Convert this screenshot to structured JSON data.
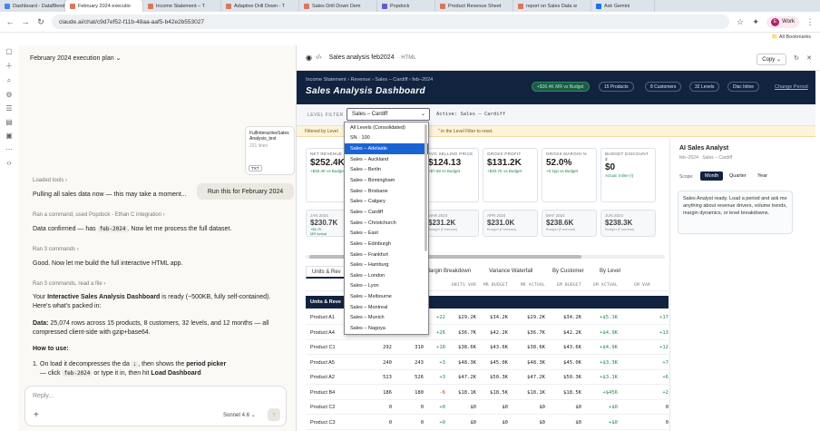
{
  "browser": {
    "tabs": [
      {
        "label": "Dashboard - DataBlend",
        "color": "#4285f4",
        "active": false
      },
      {
        "label": "February 2024 executio",
        "color": "#d97757",
        "active": true
      },
      {
        "label": "Income Statement – T",
        "color": "#d97757",
        "active": false
      },
      {
        "label": "Adaptive Drill Down - T",
        "color": "#d97757",
        "active": false
      },
      {
        "label": "Sales Drill Down Dem",
        "color": "#d97757",
        "active": false
      },
      {
        "label": "Popdock",
        "color": "#6a5acd",
        "active": false
      },
      {
        "label": "Product Revenue Sheet",
        "color": "#d97757",
        "active": false
      },
      {
        "label": "report on Sales Data w",
        "color": "#d97757",
        "active": false
      },
      {
        "label": "Ask Gemini",
        "color": "#1a73e8",
        "active": false
      }
    ],
    "url": "claude.ai/chat/c9d7ef52-f11b-48aa-aaf5-b42e2b553027",
    "profile_label": "Work",
    "profile_initial": "E",
    "bookmarks_label": "All Bookmarks"
  },
  "chat": {
    "title": "February 2024 execution plan",
    "attachment": {
      "name": "FullInteractiveSalesAnalysis_text",
      "lines": "221 lines",
      "tag": "TXT"
    },
    "user_message": "Run this for February 2024",
    "items": [
      {
        "meta": "Loaded tools ›"
      },
      {
        "text": "Pulling all sales data now — this may take a moment..."
      },
      {
        "meta": "Ran a command, used Popdock - Ethan C integration ›"
      },
      {
        "text_pre": "Data confirmed — has ",
        "code": "feb-2024",
        "text_post": ". Now let me process the full dataset."
      },
      {
        "meta": "Ran 3 commands ›"
      },
      {
        "text": "Good. Now let me build the full interactive HTML app."
      },
      {
        "meta": "Ran 3 commands, read a file ›"
      }
    ],
    "ready_pre": "Your ",
    "ready_bold": "Interactive Sales Analysis Dashboard",
    "ready_post": " is ready (~500KB, fully self-contained). Here's what's packed in:",
    "data_bold": "Data:",
    "data_text": " 25,074 rows across 15 products, 8 customers, 32 levels, and 12 months — all compressed client-side with gzip+base64.",
    "howto": "How to use:",
    "step1_pre": "On load it decompresses the da",
    "step1_mid": ", then shows the ",
    "step1_bold": "period picker",
    "step1b_pre": "— click ",
    "step1b_code": "feb-2024",
    "step1b_mid": " or type it in, then hit ",
    "step1b_bold": "Load Dashboard",
    "reply_placeholder": "Reply...",
    "model": "Sonnet 4.6 ⌄"
  },
  "artifact": {
    "title": "Sales analysis feb2024",
    "type": "· HTML",
    "copy_label": "Copy",
    "breadcrumb": "Income Statement › Revenue › Sales – Cardiff › feb–2024",
    "dash_title": "Sales Analysis Dashboard",
    "pills": [
      "+$30.4K MR vs Budget",
      "15 Products",
      "8 Customers",
      "32 Levels",
      "Disc Inline"
    ],
    "change_period": "Change Period",
    "filter_label": "LEVEL FILTER",
    "filter_value": "Sales – Cardiff",
    "active_filter": "Active: Sales – Cardiff",
    "banner_left": "Filtered by Level",
    "banner_right": "\" in the Level Filter to reset.",
    "kpis": [
      {
        "k": "NET REVENUE",
        "v": "$252.4K",
        "s": "+$30.4K vs Budget",
        "red": false
      },
      {
        "k": "",
        "v": "",
        "s": "",
        "red": false
      },
      {
        "k": "AVG SELLING PRICE",
        "v": "$124.13",
        "s": "+$7.58 vs Budget",
        "red": false
      },
      {
        "k": "GROSS PROFIT",
        "v": "$131.2K",
        "s": "+$30.7K vs Budget",
        "red": false
      },
      {
        "k": "GROSS MARGIN %",
        "v": "52.0%",
        "s": "+0.1pp vs Budget",
        "red": false
      },
      {
        "k": "BUDGET DISCOUNT $",
        "v": "$0",
        "s": "Actual: Inline (!)",
        "red": false
      }
    ],
    "months": [
      {
        "k": "JAN 2024",
        "v": "$230.7K",
        "s": "+$4.7K",
        "s2": "MR Actual"
      },
      {
        "k": "",
        "v": "",
        "s": "",
        "s2": ""
      },
      {
        "k": "MAR 2024",
        "v": "$231.2K",
        "s": "Budget (Forecast)",
        "s2": ""
      },
      {
        "k": "APR 2024",
        "v": "$231.0K",
        "s": "Budget (Forecast)",
        "s2": ""
      },
      {
        "k": "MAY 2024",
        "v": "$238.6K",
        "s": "Budget (Forecast)",
        "s2": ""
      },
      {
        "k": "JUN 2024",
        "v": "$238.3K",
        "s": "Budget (Forecast)",
        "s2": ""
      }
    ],
    "tabs": [
      "Units & Rev",
      "Margin Breakdown",
      "Variance Waterfall",
      "By Customer",
      "By Level"
    ],
    "table": {
      "headers": [
        "UNITS VAR",
        "MR BUDGET",
        "MR ACTUAL",
        "GM BUDGET",
        "GM ACTUAL",
        "GM VAR"
      ],
      "group": "Units & Reve",
      "rows": [
        {
          "name": "Product A1",
          "c1": "",
          "c2": "",
          "var": "+22",
          "b": "$29.2K",
          "a": "$34.2K",
          "gb": "$29.2K",
          "ga": "$34.2K",
          "gv": "+$5.1K",
          "gv2": "+17"
        },
        {
          "name": "Product A4",
          "c1": "",
          "c2": "",
          "var": "+26",
          "b": "$36.7K",
          "a": "$42.2K",
          "gb": "$36.7K",
          "ga": "$42.2K",
          "gv": "+$4.9K",
          "gv2": "+13"
        },
        {
          "name": "Product C1",
          "c1": "292",
          "c2": "310",
          "var": "+18",
          "b": "$38.6K",
          "a": "$43.6K",
          "gb": "$38.6K",
          "ga": "$43.6K",
          "gv": "+$4.9K",
          "gv2": "+12"
        },
        {
          "name": "Product A5",
          "c1": "240",
          "c2": "243",
          "var": "+3",
          "b": "$48.3K",
          "a": "$45.0K",
          "gb": "$48.3K",
          "ga": "$45.0K",
          "gv": "+$3.3K",
          "gv2": "+7"
        },
        {
          "name": "Product A2",
          "c1": "523",
          "c2": "526",
          "var": "+3",
          "b": "$47.2K",
          "a": "$50.3K",
          "gb": "$47.2K",
          "ga": "$50.3K",
          "gv": "+$3.1K",
          "gv2": "+6"
        },
        {
          "name": "Product B4",
          "c1": "186",
          "c2": "180",
          "var": "-6",
          "b": "$18.1K",
          "a": "$18.5K",
          "gb": "$18.1K",
          "ga": "$18.5K",
          "gv": "+$456",
          "gv2": "+2"
        },
        {
          "name": "Product C2",
          "c1": "0",
          "c2": "0",
          "var": "+0",
          "b": "$0",
          "a": "$0",
          "gb": "$0",
          "ga": "$0",
          "gv": "+$0",
          "gv2": "0"
        },
        {
          "name": "Product C3",
          "c1": "0",
          "c2": "0",
          "var": "+0",
          "b": "$0",
          "a": "$0",
          "gb": "$0",
          "ga": "$0",
          "gv": "+$0",
          "gv2": "0"
        }
      ]
    },
    "dropdown_options": [
      "All Levels (Consolidated)",
      "SN · 100",
      "Sales – Adelaide",
      "Sales – Auckland",
      "Sales – Berlin",
      "Sales – Birmingham",
      "Sales – Brisbane",
      "Sales – Calgary",
      "Sales – Cardiff",
      "Sales – Christchurch",
      "Sales – East",
      "Sales – Edinburgh",
      "Sales – Frankfurt",
      "Sales – Hamburg",
      "Sales – London",
      "Sales – Lyon",
      "Sales – Melbourne",
      "Sales – Montreal",
      "Sales – Munich",
      "Sales – Nagoya"
    ],
    "dropdown_highlight": 2,
    "analyst": {
      "title": "AI Sales Analyst",
      "sub": "feb–2024 · Sales – Cardiff",
      "scope_label": "Scope:",
      "scopes": [
        "Month",
        "Quarter",
        "Year"
      ],
      "message": "Sales Analyst ready. Load a period and ask me anything about revenue drivers, volume trends, margin dynamics, or level breakdowns."
    }
  }
}
